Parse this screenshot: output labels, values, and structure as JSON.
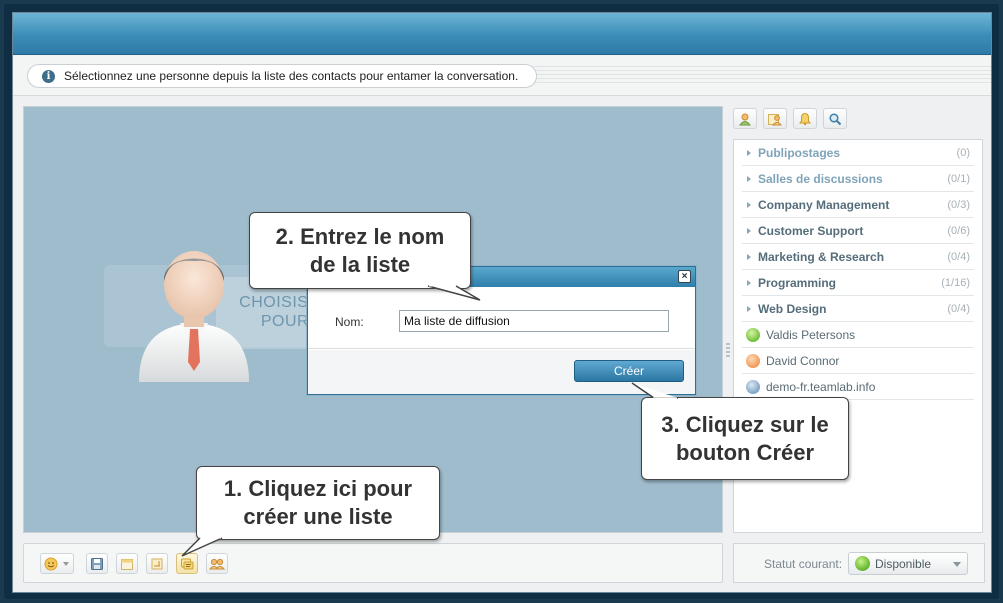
{
  "info_message": "Sélectionnez une personne depuis la liste des contacts pour entamer la conversation.",
  "welcome": {
    "line1": "CHOISISSE",
    "line2": "POUR"
  },
  "contacts": {
    "groups": [
      {
        "name": "Publipostages",
        "count": "(0)",
        "style": "blue"
      },
      {
        "name": "Salles de discussions",
        "count": "(0/1)",
        "style": "blue"
      },
      {
        "name": "Company Management",
        "count": "(0/3)",
        "style": "dark"
      },
      {
        "name": "Customer Support",
        "count": "(0/6)",
        "style": "dark"
      },
      {
        "name": "Marketing & Research",
        "count": "(0/4)",
        "style": "dark"
      },
      {
        "name": "Programming",
        "count": "(1/16)",
        "style": "dark"
      },
      {
        "name": "Web Design",
        "count": "(0/4)",
        "style": "dark"
      }
    ],
    "people": [
      {
        "name": "Valdis Petersons",
        "status_color": "#7cc444"
      },
      {
        "name": "David Connor",
        "status_color": "#f0a060"
      },
      {
        "name": "demo-fr.teamlab.info",
        "status_color": "#7fa3c4"
      }
    ]
  },
  "status": {
    "label": "Statut courant:",
    "value": "Disponible"
  },
  "dialog": {
    "field_label": "Nom:",
    "field_value": "Ma liste de diffusion",
    "button": "Créer",
    "close": "×"
  },
  "callouts": {
    "step1": "1. Cliquez ici pour créer une liste",
    "step2": "2. Entrez le nom de la liste",
    "step3": "3. Cliquez sur le bouton Créer"
  },
  "icons": {
    "toolbar": [
      "smiley-icon",
      "save-icon",
      "calendar-icon",
      "folder-icon",
      "broadcast-list-icon",
      "group-icon"
    ],
    "right": [
      "contact-icon",
      "folder-users-icon",
      "bell-icon",
      "search-icon"
    ]
  }
}
